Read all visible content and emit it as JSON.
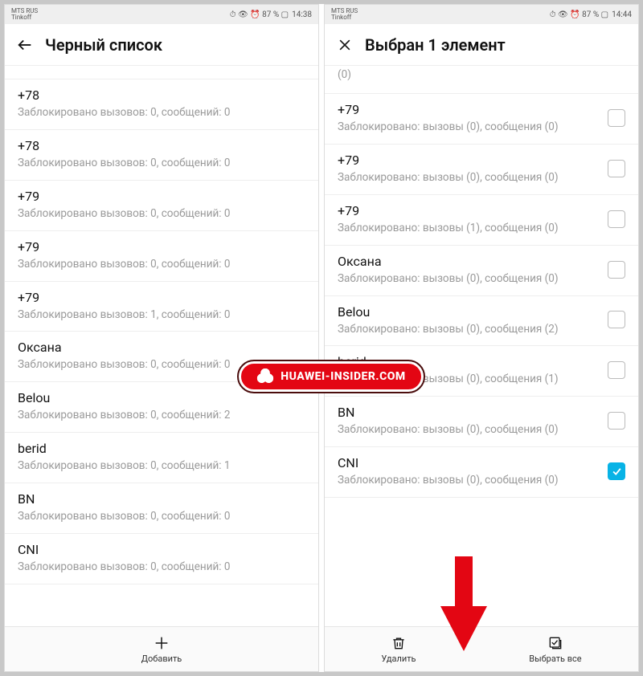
{
  "statusbar": {
    "operator1": "MTS RUS",
    "operator2": "Tinkoff",
    "icons": "⏱ 👁 ⏰ 87 % ▢",
    "time_left": "14:38",
    "time_right": "14:44"
  },
  "left": {
    "title": "Черный список",
    "partial_top_sub": "",
    "rows": [
      {
        "title": "+78",
        "sub": "Заблокировано вызовов: 0, сообщений: 0"
      },
      {
        "title": "+78",
        "sub": "Заблокировано вызовов: 0, сообщений: 0"
      },
      {
        "title": "+79",
        "sub": "Заблокировано вызовов: 0, сообщений: 0"
      },
      {
        "title": "+79",
        "sub": "Заблокировано вызовов: 0, сообщений: 0"
      },
      {
        "title": "+79",
        "sub": "Заблокировано вызовов: 1, сообщений: 0"
      },
      {
        "title": "Оксана",
        "sub": "Заблокировано вызовов: 0, сообщений: 0"
      },
      {
        "title": "Belou",
        "sub": "Заблокировано вызовов: 0, сообщений: 2"
      },
      {
        "title": "berid",
        "sub": "Заблокировано вызовов: 0, сообщений: 1"
      },
      {
        "title": "BN",
        "sub": "Заблокировано вызовов: 0, сообщений: 0"
      },
      {
        "title": "CNI",
        "sub": "Заблокировано вызовов: 0, сообщений: 0"
      }
    ],
    "bottom": {
      "add_label": "Добавить"
    }
  },
  "right": {
    "title": "Выбран 1 элемент",
    "partial_top_sub": "(0)",
    "rows": [
      {
        "title": "+79",
        "sub": "Заблокировано: вызовы (0), сообщения (0)",
        "checked": false
      },
      {
        "title": "+79",
        "sub": "Заблокировано: вызовы (0), сообщения (0)",
        "checked": false
      },
      {
        "title": "+79",
        "sub": "Заблокировано: вызовы (1), сообщения (0)",
        "checked": false
      },
      {
        "title": "Оксана",
        "sub": "Заблокировано: вызовы (0), сообщения (0)",
        "checked": false
      },
      {
        "title": "Belou",
        "sub": "Заблокировано: вызовы (0), сообщения (2)",
        "checked": false
      },
      {
        "title": "berid",
        "sub": "Заблокировано: вызовы (0), сообщения (1)",
        "checked": false
      },
      {
        "title": "BN",
        "sub": "Заблокировано: вызовы (0), сообщения (0)",
        "checked": false
      },
      {
        "title": "CNI",
        "sub": "Заблокировано: вызовы (0), сообщения (0)",
        "checked": true
      }
    ],
    "bottom": {
      "delete_label": "Удалить",
      "select_all_label": "Выбрать все"
    }
  },
  "watermark": "HUAWEI-INSIDER.COM"
}
